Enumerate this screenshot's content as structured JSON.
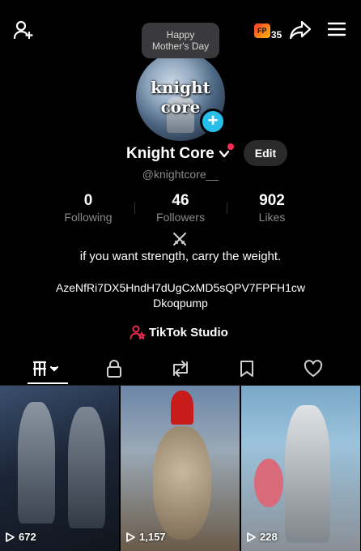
{
  "header": {
    "promo_badge": "FP",
    "promo_count": "35",
    "tooltip_line1": "Happy",
    "tooltip_line2": "Mother's Day"
  },
  "profile": {
    "avatar_text": "knight core",
    "name": "Knight Core",
    "username": "@knightcore__",
    "edit_label": "Edit",
    "accent_color": "#25bfe9"
  },
  "stats": [
    {
      "value": "0",
      "label": "Following"
    },
    {
      "value": "46",
      "label": "Followers"
    },
    {
      "value": "902",
      "label": "Likes"
    }
  ],
  "bio": {
    "line1": "if you want strength, carry the weight.",
    "address_line1": "AzeNfRi7DX5HndH7dUgCxMD5sQPV7FPFH1cw",
    "address_line2": "Dkoqpump"
  },
  "studio": {
    "label": "TikTok Studio"
  },
  "tabs": [
    {
      "icon": "videos-grid-icon",
      "active": true
    },
    {
      "icon": "lock-icon",
      "active": false
    },
    {
      "icon": "repost-icon",
      "active": false
    },
    {
      "icon": "bookmark-icon",
      "active": false
    },
    {
      "icon": "heart-icon",
      "active": false
    }
  ],
  "videos": [
    {
      "views": "672"
    },
    {
      "views": "1,157"
    },
    {
      "views": "228"
    }
  ]
}
